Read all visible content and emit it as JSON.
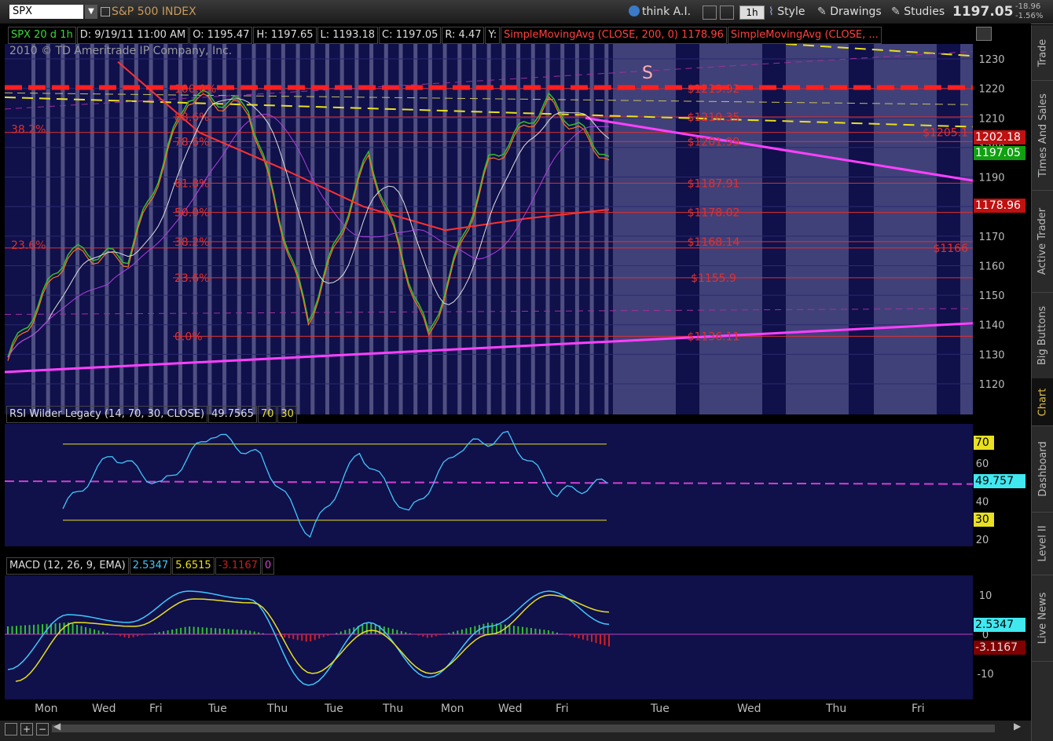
{
  "toolbar": {
    "symbol": "SPX",
    "index_name": "S&P 500 INDEX",
    "think_ai": "think A.I.",
    "aggregation": "1h",
    "style": "Style",
    "drawings": "Drawings",
    "studies": "Studies",
    "last_price": "1197.05",
    "change": "-18.96",
    "change_pct": "-1.56%"
  },
  "side_tabs": [
    "Trade",
    "Times And Sales",
    "Active Trader",
    "Big Buttons",
    "Chart",
    "Dashboard",
    "Level II",
    "Live News"
  ],
  "active_side_tab": "Chart",
  "header": {
    "study": "SPX 20 d 1h",
    "date": "D: 9/19/11 11:00 AM",
    "open": "O: 1195.47",
    "high": "H: 1197.65",
    "low": "L: 1193.18",
    "close": "C: 1197.05",
    "range": "R: 4.47",
    "y": "Y:",
    "sma200": "SimpleMovingAvg (CLOSE, 200, 0) 1178.96",
    "sma2": "SimpleMovingAvg (CLOSE, ..."
  },
  "copyright": "2010 © TD Ameritrade IP Company, Inc.",
  "fib_left": [
    "100.0%",
    "88.6%",
    "78.6%",
    "61.8%",
    "50.0%",
    "38.2%",
    "23.6%",
    "0.0%"
  ],
  "fib_left_outer": [
    "38.2%",
    "23.6%"
  ],
  "fib_right": [
    "$1219.92",
    "$1210.35",
    "$1201.99",
    "$1187.91",
    "$1178.02",
    "$1168.14",
    "$1155.9",
    "$1136.11"
  ],
  "right_notes": [
    "$1205.1",
    "$1166"
  ],
  "sell_marker": "S",
  "price_tags": {
    "a": "1202.18",
    "b": "1197.05",
    "c": "1178.96"
  },
  "rsi": {
    "title": "RSI Wilder Legacy (14, 70, 30, CLOSE)",
    "value": "49.7565",
    "ob": "70",
    "os": "30",
    "tag_value": "49.757",
    "tag_ob": "70",
    "tag_os": "30"
  },
  "macd": {
    "title": "MACD (12, 26, 9, EMA)",
    "value": "2.5347",
    "avg": "5.6515",
    "diff": "-3.1167",
    "zero": "0",
    "tag_value": "2.5347",
    "tag_diff": "-3.1167"
  },
  "x_labels": [
    "Mon",
    "Wed",
    "Fri",
    "Tue",
    "Thu",
    "Tue",
    "Thu",
    "Mon",
    "Wed",
    "Fri",
    "Tue",
    "Wed",
    "Thu",
    "Fri"
  ],
  "colors": {
    "panel_bg": "#10104a",
    "fib": "#e03030",
    "sma200": "#ff3030",
    "trend": "#ff40ff",
    "yellow": "#e8e020",
    "rsi": "#40c8ff",
    "macd_line": "#40c8ff",
    "macd_avg": "#e8e020"
  },
  "chart_data": [
    {
      "type": "line",
      "title": "SPX 20 d 1h",
      "ylim": [
        1117,
        1237
      ],
      "y_ticks": [
        1120,
        1130,
        1140,
        1150,
        1160,
        1170,
        1180,
        1190,
        1200,
        1210,
        1220,
        1230
      ],
      "categories": [
        "Mon",
        "Wed",
        "Fri",
        "Tue",
        "Thu",
        "Tue",
        "Thu",
        "Mon",
        "Wed",
        "Fri"
      ],
      "series": [
        {
          "name": "SPX",
          "values": [
            1129,
            1165,
            1163,
            1218,
            1214,
            1142,
            1198,
            1136,
            1195,
            1216,
            1197
          ]
        },
        {
          "name": "SimpleMovingAvg (CLOSE, 200, 0)",
          "values": [
            1229,
            1205,
            1193,
            1180,
            1172,
            1176,
            1179
          ]
        }
      ],
      "horizontal_levels": [
        1219.92,
        1210.35,
        1201.99,
        1187.91,
        1178.02,
        1168.14,
        1155.9,
        1136.11
      ],
      "grid": true
    },
    {
      "type": "line",
      "title": "RSI Wilder Legacy (14, 70, 30, CLOSE)",
      "ylim": [
        15,
        80
      ],
      "y_ticks": [
        20,
        40,
        60
      ],
      "series": [
        {
          "name": "RSI",
          "values": [
            36,
            65,
            48,
            76,
            63,
            22,
            66,
            33,
            68,
            74,
            44,
            49.76
          ]
        }
      ]
    },
    {
      "type": "line",
      "title": "MACD (12, 26, 9, EMA)",
      "ylim": [
        -16,
        14
      ],
      "y_ticks": [
        -10,
        0,
        10
      ],
      "series": [
        {
          "name": "MACD",
          "values": [
            -9,
            5,
            3,
            11,
            9,
            -13,
            3,
            -11,
            2,
            11,
            2.53
          ]
        },
        {
          "name": "Avg",
          "values": [
            -12,
            3,
            2,
            9,
            8,
            -10,
            1,
            -10,
            0,
            10,
            5.65
          ]
        },
        {
          "name": "Diff",
          "values": [
            2,
            3,
            -1,
            2,
            1,
            -2,
            3,
            -1,
            3,
            1,
            -3.12
          ]
        }
      ]
    }
  ]
}
